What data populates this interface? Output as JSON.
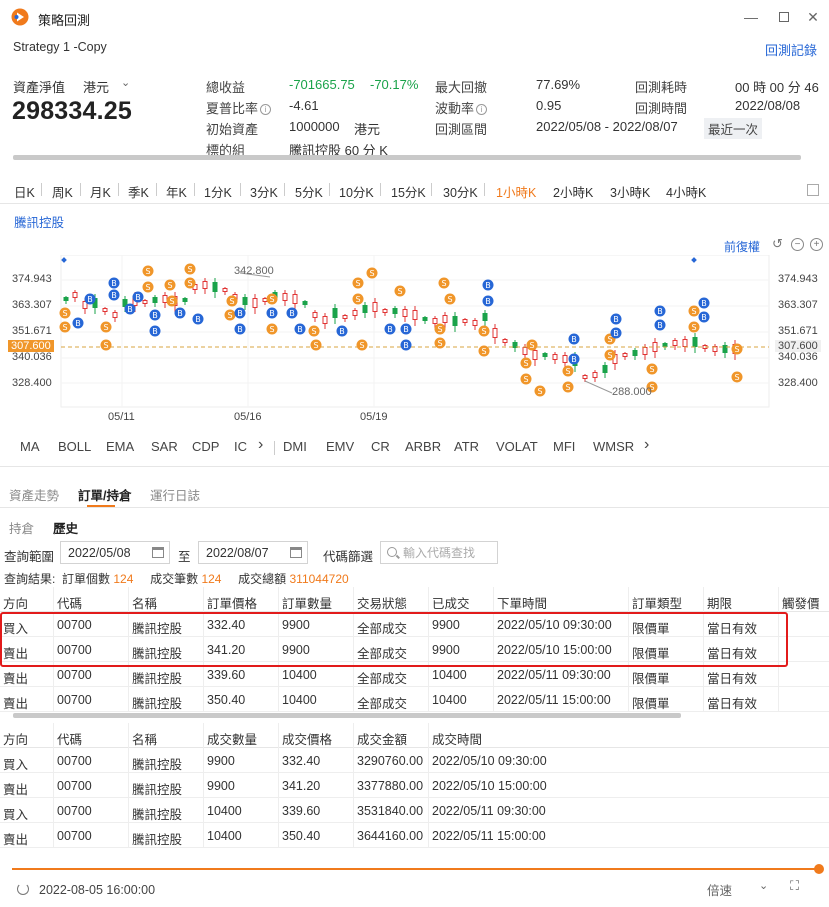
{
  "window": {
    "title": "策略回測",
    "strategy_name": "Strategy 1 -Copy",
    "backtest_record_label": "回測記錄"
  },
  "summary": {
    "nav_label": "資產淨值",
    "currency": "港元",
    "nav_value": "298334.25",
    "stats": {
      "total_return_label": "總收益",
      "total_return_amount": "-701665.75",
      "total_return_pct": "-70.17%",
      "sharpe_label": "夏普比率",
      "sharpe_value": "-4.61",
      "initial_capital_label": "初始資產",
      "initial_capital_value": "1000000",
      "initial_capital_currency": "港元",
      "target_label": "標的組",
      "target_value": "騰訊控股 60 分 K",
      "max_drawdown_label": "最大回撤",
      "max_drawdown_value": "77.69%",
      "volatility_label": "波動率",
      "volatility_value": "0.95",
      "backtest_range_label": "回測區間",
      "backtest_range_value": "2022/05/08 - 2022/08/07",
      "recent_badge": "最近一次",
      "duration_label": "回測耗時",
      "duration_value": "00 時 00 分 46",
      "backtest_time_label": "回測時間",
      "backtest_time_value": "2022/08/08"
    }
  },
  "timeframes": [
    "日K",
    "周K",
    "月K",
    "季K",
    "年K",
    "1分K",
    "3分K",
    "5分K",
    "10分K",
    "15分K",
    "30分K",
    "1小時K",
    "2小時K",
    "3小時K",
    "4小時K"
  ],
  "active_timeframe": "1小時K",
  "chart": {
    "symbol": "騰訊控股",
    "adjust_label": "前復權",
    "y_labels": [
      "374.943",
      "363.307",
      "351.671",
      "340.036",
      "328.400"
    ],
    "current_price": "307.600",
    "x_labels": [
      "05/11",
      "05/16",
      "05/19"
    ],
    "high_label": "342.800",
    "low_label": "288.000",
    "colors": {
      "up": "#e03434",
      "down": "#1aa34a",
      "buy": "#2767d6",
      "sell": "#f0962a",
      "price_line": "#d9a441"
    }
  },
  "indicators": {
    "main": [
      "MA",
      "BOLL",
      "EMA",
      "SAR",
      "CDP",
      "IC"
    ],
    "sub": [
      "DMI",
      "EMV",
      "CR",
      "ARBR",
      "ATR",
      "VOLAT",
      "MFI",
      "WMSR"
    ]
  },
  "section_tabs": [
    "資產走勢",
    "訂單/持倉",
    "運行日誌"
  ],
  "sub_tabs": [
    "持倉",
    "歷史"
  ],
  "query": {
    "range_label": "查詢範圍",
    "from_date": "2022/05/08",
    "to_label": "至",
    "to_date": "2022/08/07",
    "filter_label": "代碼篩選",
    "search_placeholder": "輸入代碼查找",
    "result_label": "查詢結果:",
    "order_count_label": "訂單個數",
    "order_count": "124",
    "fill_count_label": "成交筆數",
    "fill_count": "124",
    "fill_total_label": "成交總額",
    "fill_total": "311044720"
  },
  "orders": {
    "headers": [
      "方向",
      "代碼",
      "名稱",
      "訂單價格",
      "訂單數量",
      "交易狀態",
      "已成交",
      "下單時間",
      "訂單類型",
      "期限",
      "觸發價"
    ],
    "rows": [
      [
        "買入",
        "00700",
        "騰訊控股",
        "332.40",
        "9900",
        "全部成交",
        "9900",
        "2022/05/10 09:30:00",
        "限價單",
        "當日有效"
      ],
      [
        "賣出",
        "00700",
        "騰訊控股",
        "341.20",
        "9900",
        "全部成交",
        "9900",
        "2022/05/10 15:00:00",
        "限價單",
        "當日有效"
      ],
      [
        "賣出",
        "00700",
        "騰訊控股",
        "339.60",
        "10400",
        "全部成交",
        "10400",
        "2022/05/11 09:30:00",
        "限價單",
        "當日有效"
      ],
      [
        "賣出",
        "00700",
        "騰訊控股",
        "350.40",
        "10400",
        "全部成交",
        "10400",
        "2022/05/11 15:00:00",
        "限價單",
        "當日有效"
      ]
    ]
  },
  "fills": {
    "headers": [
      "方向",
      "代碼",
      "名稱",
      "成交數量",
      "成交價格",
      "成交金額",
      "成交時間"
    ],
    "rows": [
      [
        "買入",
        "00700",
        "騰訊控股",
        "9900",
        "332.40",
        "3290760.00",
        "2022/05/10 09:30:00"
      ],
      [
        "賣出",
        "00700",
        "騰訊控股",
        "9900",
        "341.20",
        "3377880.00",
        "2022/05/10 15:00:00"
      ],
      [
        "買入",
        "00700",
        "騰訊控股",
        "10400",
        "339.60",
        "3531840.00",
        "2022/05/11 09:30:00"
      ],
      [
        "賣出",
        "00700",
        "騰訊控股",
        "10400",
        "350.40",
        "3644160.00",
        "2022/05/11 15:00:00"
      ]
    ]
  },
  "bottom": {
    "time": "2022-08-05 16:00:00",
    "speed_label": "倍速"
  }
}
